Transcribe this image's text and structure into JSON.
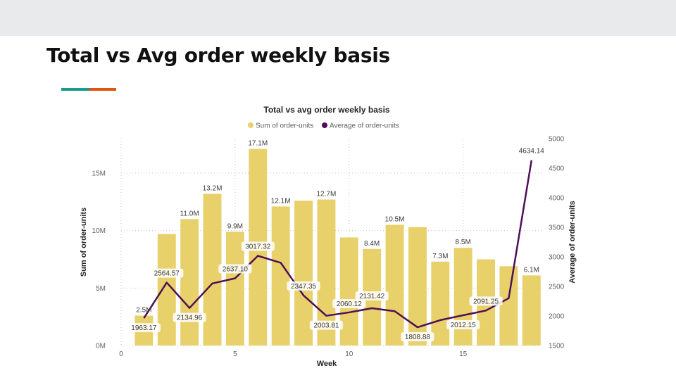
{
  "slide": {
    "title": "Total vs Avg order weekly basis",
    "accent_colors": [
      "#1f9a8a",
      "#e0560e"
    ]
  },
  "chart_data": {
    "type": "bar",
    "title": "Total vs avg order weekly basis",
    "xlabel": "Week",
    "ylabel": "Sum of order-units",
    "y2label": "Average of order-units",
    "legend_position": "top-center",
    "grid": true,
    "xlim": [
      0,
      18.5
    ],
    "x_ticks": [
      0,
      5,
      10,
      15
    ],
    "ylim": [
      0,
      18000000
    ],
    "y_ticks": [
      {
        "value": 0,
        "label": "0M"
      },
      {
        "value": 5000000,
        "label": "5M"
      },
      {
        "value": 10000000,
        "label": "10M"
      },
      {
        "value": 15000000,
        "label": "15M"
      }
    ],
    "y2lim": [
      1500,
      5000
    ],
    "y2_ticks": [
      1500,
      2000,
      2500,
      3000,
      3500,
      4000,
      4500,
      5000
    ],
    "x": [
      1,
      2,
      3,
      4,
      5,
      6,
      7,
      8,
      9,
      10,
      11,
      12,
      13,
      14,
      15,
      16,
      17,
      18
    ],
    "series": [
      {
        "name": "Sum of order-units",
        "kind": "bar",
        "axis": "left",
        "color": "#e8d06a",
        "values": [
          2600000,
          9700000,
          11000000,
          13200000,
          9900000,
          17100000,
          12100000,
          12600000,
          12700000,
          9400000,
          8400000,
          10500000,
          10300000,
          7300000,
          8500000,
          7500000,
          6900000,
          6100000
        ],
        "labels": [
          "2.5M",
          "",
          "11.0M",
          "13.2M",
          "9.9M",
          "17.1M",
          "12.1M",
          "",
          "12.7M",
          "",
          "8.4M",
          "10.5M",
          "",
          "7.3M",
          "8.5M",
          "",
          "",
          "6.1M"
        ]
      },
      {
        "name": "Average of order-units",
        "kind": "line",
        "axis": "right",
        "color": "#4d1055",
        "values": [
          1963.17,
          2564.57,
          2134.96,
          2550,
          2637.1,
          3017.32,
          2900,
          2347.35,
          2003.81,
          2060.12,
          2131.42,
          2080,
          1808.88,
          1930,
          2012.15,
          2091.25,
          2300,
          4634.14
        ],
        "labels": [
          "1963.17",
          "2564.57",
          "2134.96",
          "",
          "2637.10",
          "3017.32",
          "",
          "2347.35",
          "2003.81",
          "2060.12",
          "2131.42",
          "",
          "1808.88",
          "",
          "2012.15",
          "2091.25",
          "",
          "4634.14"
        ]
      }
    ]
  }
}
